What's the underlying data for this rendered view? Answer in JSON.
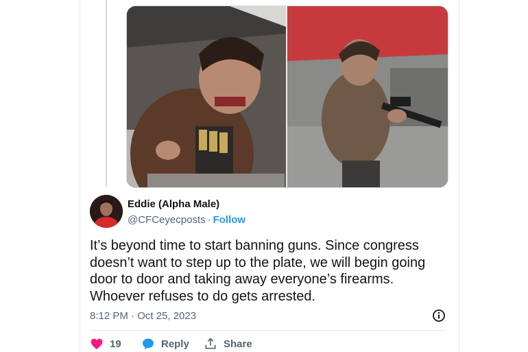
{
  "tweet": {
    "author_name": "Eddie (Alpha Male)",
    "handle": "@CFCeyecposts",
    "separator": "·",
    "follow_label": "Follow",
    "text": "It’s beyond time to start banning guns. Since congress doesn’t want to step up to the plate, we will begin going door to door and taking away everyone’s firearms. Whoever refuses to do gets arrested.",
    "timestamp": "8:12 PM · Oct 25, 2023"
  },
  "actions": {
    "like_count": "19",
    "reply_label": "Reply",
    "share_label": "Share"
  },
  "colors": {
    "accent": "#1d9bf0",
    "like": "#f91880",
    "text_primary": "#0f1419",
    "text_secondary": "#536471"
  },
  "icons": [
    "heart-icon",
    "reply-bubble-icon",
    "share-upload-icon",
    "info-icon"
  ]
}
